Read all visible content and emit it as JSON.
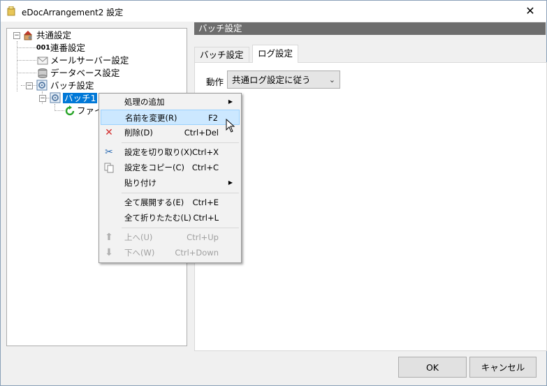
{
  "window": {
    "title": "eDocArrangement2 設定",
    "close_glyph": "✕"
  },
  "tree": {
    "nodes": [
      {
        "label": "共通設定",
        "icon": "house-gear-icon"
      },
      {
        "label": "連番設定",
        "icon": "numbering-001-icon",
        "badge": "001"
      },
      {
        "label": "メールサーバー設定",
        "icon": "mail-envelope-icon"
      },
      {
        "label": "データベース設定",
        "icon": "database-icon"
      },
      {
        "label": "バッチ設定",
        "icon": "batch-gear-icon"
      },
      {
        "label": "バッチ1",
        "icon": "batch-gear-icon",
        "selected": true
      },
      {
        "label": "ファイ",
        "icon": "green-refresh-icon"
      }
    ],
    "expander_minus": "−"
  },
  "right": {
    "section_title": "バッチ設定",
    "tabs": [
      {
        "label": "バッチ設定",
        "active": false
      },
      {
        "label": "ログ設定",
        "active": true
      }
    ],
    "operation_label": "動作",
    "operation_value": "共通ログ設定に従う",
    "chevron": "⌄"
  },
  "buttons": {
    "ok": "OK",
    "cancel": "キャンセル"
  },
  "context_menu": {
    "items": [
      {
        "label": "処理の追加",
        "shortcut": "",
        "submenu": true,
        "icon": ""
      },
      {
        "label": "名前を変更(R)",
        "shortcut": "F2",
        "highlight": true,
        "icon": ""
      },
      {
        "label": "削除(D)",
        "shortcut": "Ctrl+Del",
        "icon": "red-x-icon"
      },
      {
        "label": "設定を切り取り(X)",
        "shortcut": "Ctrl+X",
        "icon": "scissors-icon"
      },
      {
        "label": "設定をコピー(C)",
        "shortcut": "Ctrl+C",
        "icon": "copy-icon"
      },
      {
        "label": "貼り付け",
        "shortcut": "",
        "submenu": true,
        "icon": ""
      },
      {
        "label": "全て展開する(E)",
        "shortcut": "Ctrl+E",
        "icon": ""
      },
      {
        "label": "全て折りたたむ(L)",
        "shortcut": "Ctrl+L",
        "icon": ""
      },
      {
        "label": "上へ(U)",
        "shortcut": "Ctrl+Up",
        "disabled": true,
        "icon": "up-arrow-icon"
      },
      {
        "label": "下へ(W)",
        "shortcut": "Ctrl+Down",
        "disabled": true,
        "icon": "down-arrow-icon"
      }
    ],
    "submenu_arrow": "▶"
  },
  "colors": {
    "accent": "#0078d7",
    "header_bar": "#6d6d6d",
    "menu_highlight": "#cce8ff"
  }
}
